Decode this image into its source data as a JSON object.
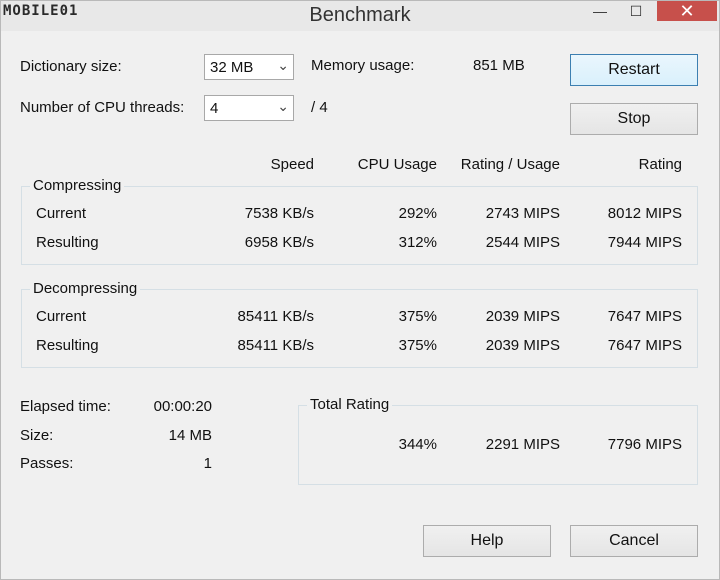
{
  "titlebar": {
    "logo": "MOBILE01",
    "title": "Benchmark",
    "minimize": "—",
    "maximize": "☐",
    "close": "✕"
  },
  "settings": {
    "dictionary_label": "Dictionary size:",
    "dictionary_value": "32 MB",
    "threads_label": "Number of CPU threads:",
    "threads_value": "4",
    "threads_max": "/ 4",
    "memory_label": "Memory usage:",
    "memory_value": "851 MB"
  },
  "buttons": {
    "restart": "Restart",
    "stop": "Stop",
    "help": "Help",
    "cancel": "Cancel"
  },
  "columns": {
    "speed": "Speed",
    "cpu_usage": "CPU Usage",
    "rating_usage": "Rating / Usage",
    "rating": "Rating"
  },
  "compressing": {
    "title": "Compressing",
    "current": {
      "label": "Current",
      "speed": "7538 KB/s",
      "cpu": "292%",
      "rating_usage": "2743 MIPS",
      "rating": "8012 MIPS"
    },
    "resulting": {
      "label": "Resulting",
      "speed": "6958 KB/s",
      "cpu": "312%",
      "rating_usage": "2544 MIPS",
      "rating": "7944 MIPS"
    }
  },
  "decompressing": {
    "title": "Decompressing",
    "current": {
      "label": "Current",
      "speed": "85411 KB/s",
      "cpu": "375%",
      "rating_usage": "2039 MIPS",
      "rating": "7647 MIPS"
    },
    "resulting": {
      "label": "Resulting",
      "speed": "85411 KB/s",
      "cpu": "375%",
      "rating_usage": "2039 MIPS",
      "rating": "7647 MIPS"
    }
  },
  "stats": {
    "elapsed_label": "Elapsed time:",
    "elapsed_value": "00:00:20",
    "size_label": "Size:",
    "size_value": "14 MB",
    "passes_label": "Passes:",
    "passes_value": "1"
  },
  "total": {
    "title": "Total Rating",
    "cpu": "344%",
    "rating_usage": "2291 MIPS",
    "rating": "7796 MIPS"
  },
  "colors": {
    "close_button": "#c7504b",
    "focus_border": "#3c7fb1",
    "window_bg": "#f0f0f0"
  },
  "icons": {
    "minimize": "minimize-icon",
    "maximize": "maximize-icon",
    "close": "close-icon",
    "dropdown": "chevron-down-icon"
  }
}
